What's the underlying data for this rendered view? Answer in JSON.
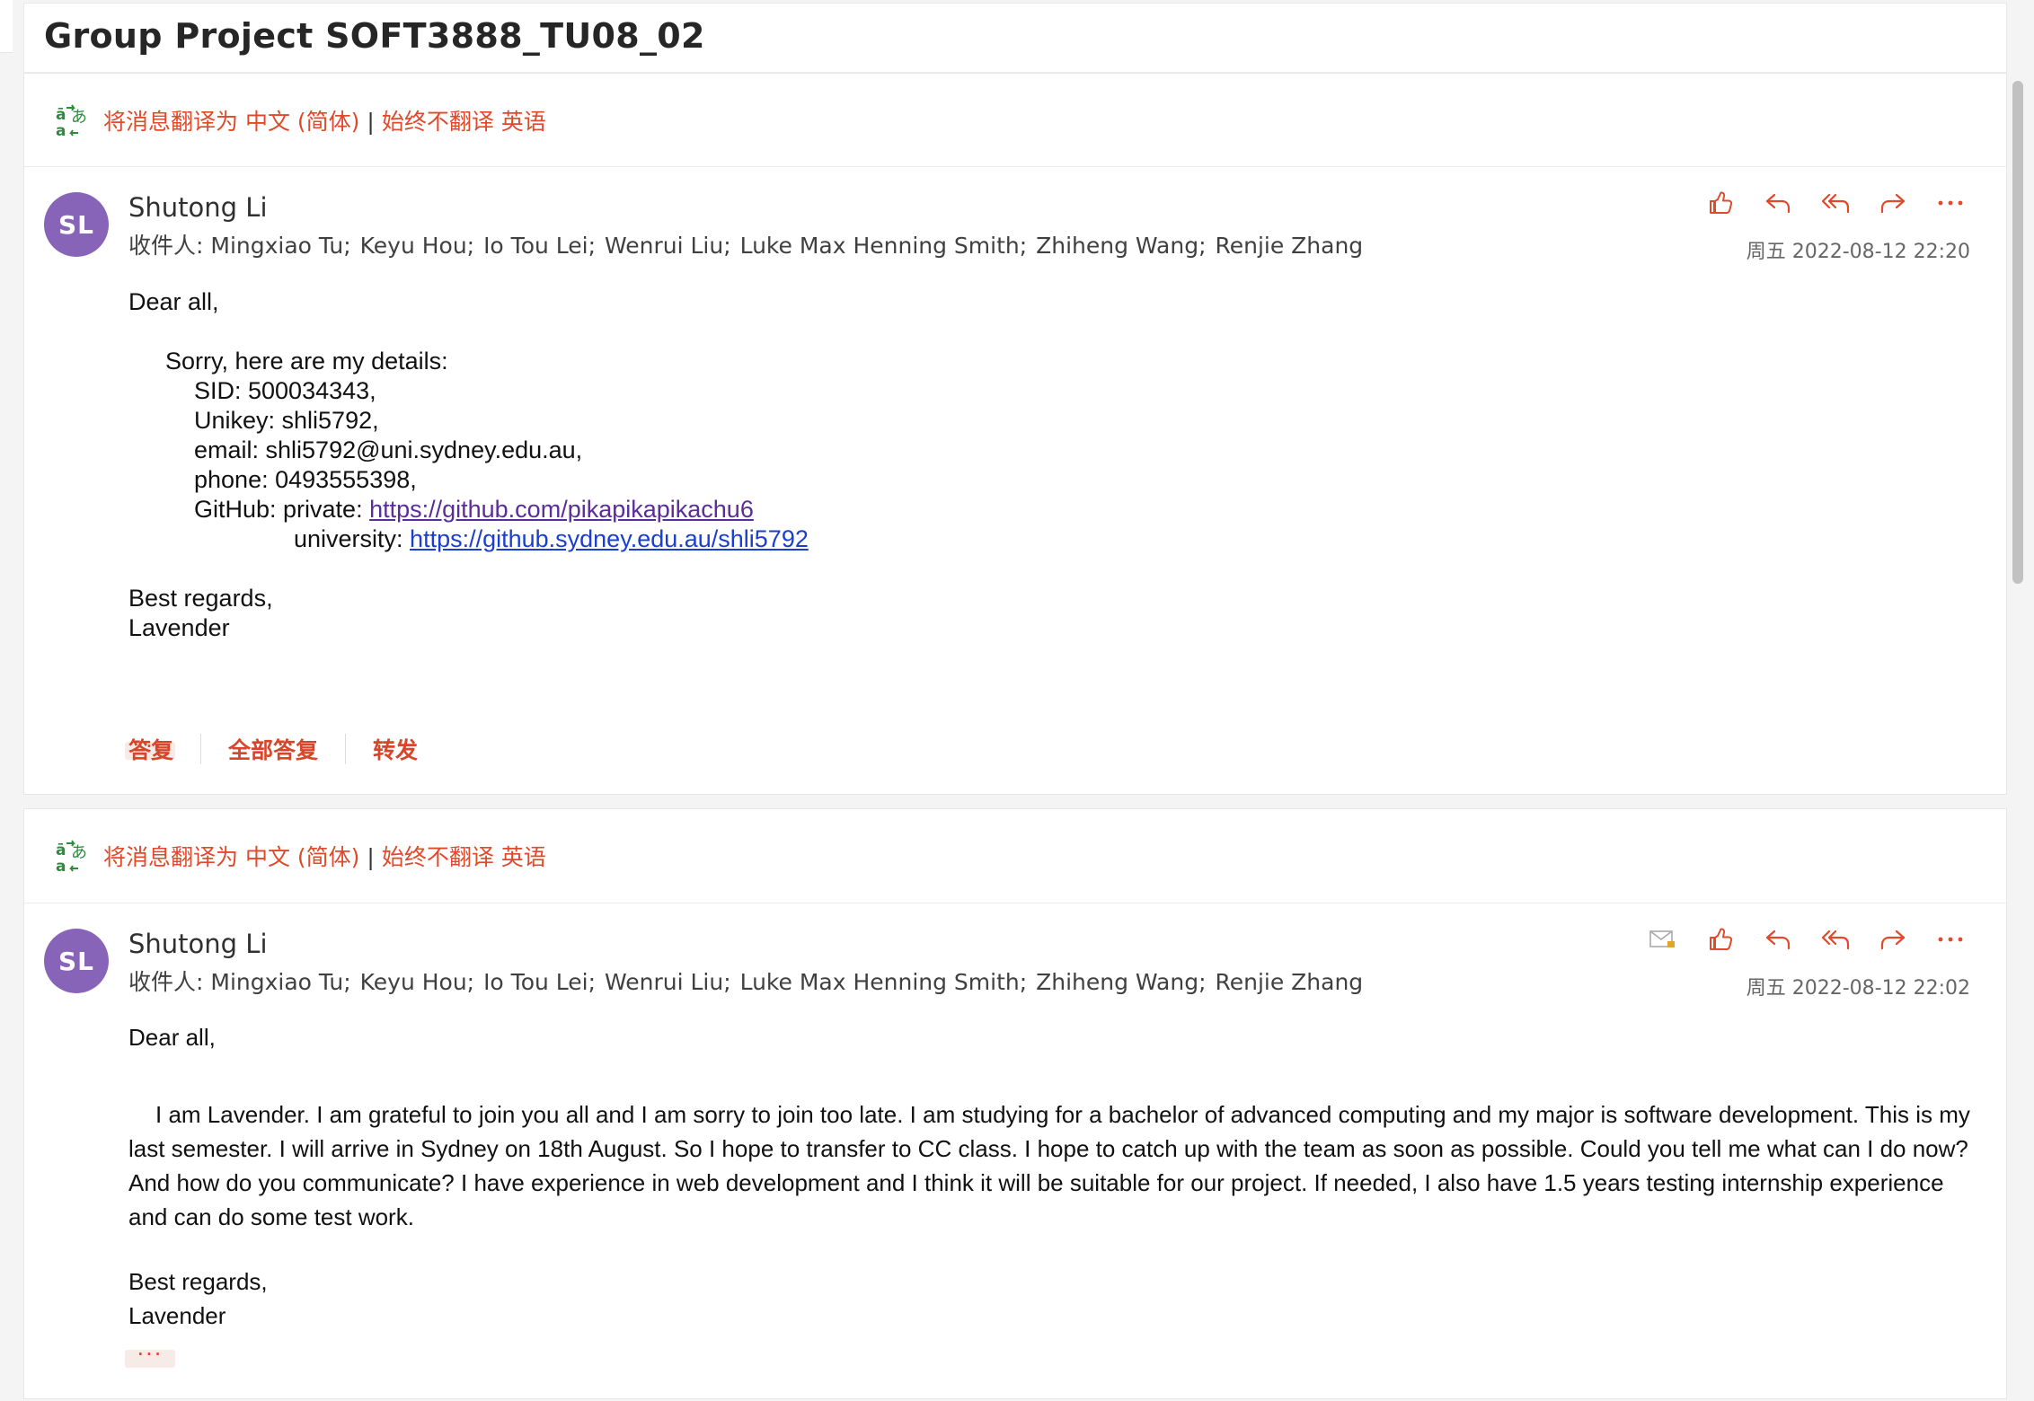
{
  "subject": "Group Project SOFT3888_TU08_02",
  "translate_bar": {
    "translate_label": "将消息翻译为 中文 (简体)",
    "separator": "|",
    "never_label": "始终不翻译 英语"
  },
  "messages": [
    {
      "avatar_initials": "SL",
      "sender": "Shutong Li",
      "recipients_label": "收件人:",
      "recipients": [
        "Mingxiao Tu;",
        "Keyu Hou;",
        "Io Tou Lei;",
        "Wenrui Liu;",
        "Luke Max Henning Smith;",
        "Zhiheng Wang;",
        "Renjie Zhang"
      ],
      "date": "周五 2022-08-12 22:20",
      "body": {
        "greeting": "Dear all,",
        "intro": "Sorry, here are my details:",
        "sid": "SID: 500034343,",
        "unikey": "Unikey: shli5792,",
        "email": "email: shli5792@uni.sydney.edu.au,",
        "phone": "phone: 0493555398,",
        "github_private_label": "GitHub: private: ",
        "github_private_url": "https://github.com/pikapikapikachu6",
        "github_uni_label": "university: ",
        "github_uni_url": "https://github.sydney.edu.au/shli5792",
        "closing": "Best regards,",
        "signature": "Lavender"
      },
      "more": "···",
      "reply": "答复",
      "reply_all": "全部答复",
      "forward": "转发"
    },
    {
      "avatar_initials": "SL",
      "sender": "Shutong Li",
      "recipients_label": "收件人:",
      "recipients": [
        "Mingxiao Tu;",
        "Keyu Hou;",
        "Io Tou Lei;",
        "Wenrui Liu;",
        "Luke Max Henning Smith;",
        "Zhiheng Wang;",
        "Renjie Zhang"
      ],
      "date": "周五 2022-08-12 22:02",
      "body": {
        "greeting": "Dear all,",
        "paragraph": "I am Lavender. I am grateful to join you all and I am sorry to join too late. I am studying for a bachelor of advanced computing and my major is software development. This is my last semester. I will arrive in Sydney on 18th August. So I hope to transfer to CC class.  I hope to catch up with the team as soon as possible. Could you tell me what can I do now? And how do you communicate? I have experience in web development and I think it will be suitable for our project. If needed,  I also have 1.5 years testing internship experience and can do some test work.",
        "closing": "Best regards,",
        "signature": "Lavender"
      },
      "more": "···"
    }
  ],
  "colors": {
    "accent": "#e0492a",
    "avatar": "#8764b8",
    "link": "#1a3fcf",
    "visited_link": "#5b2d98"
  }
}
